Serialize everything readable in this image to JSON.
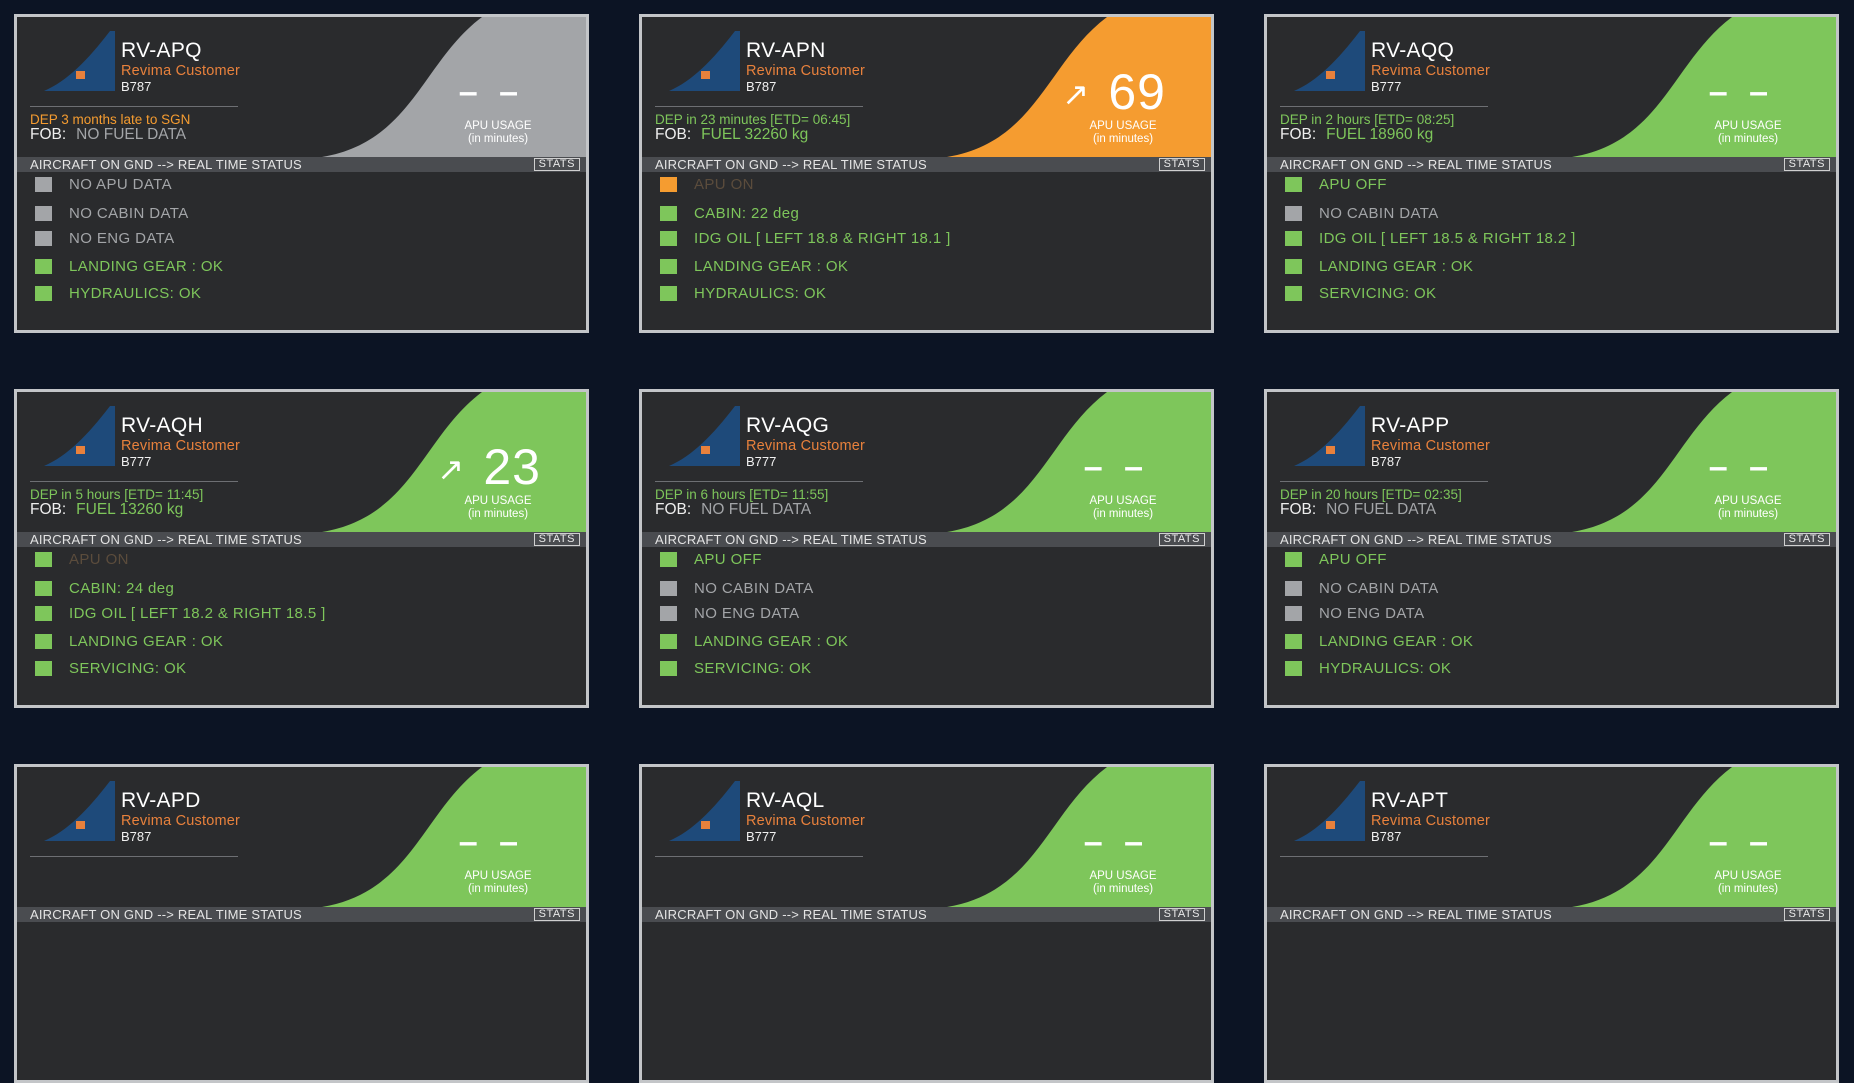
{
  "colors": {
    "background": "#0c1424",
    "panel": "#2a2b2d",
    "green": "#7ec65b",
    "orange": "#f59c30",
    "grey": "#a3a5a8",
    "dim": "#5b4c3c",
    "customer": "#e8813c",
    "tail_blue": "#1e4a7a",
    "tail_square": "#e8813c"
  },
  "labels": {
    "apu_usage": "APU USAGE",
    "apu_unit": "(in minutes)",
    "status_bar": "AIRCRAFT ON GND --> REAL TIME STATUS",
    "stats": "STATS",
    "fob": "FOB:",
    "arrow": "↗"
  },
  "cards": [
    {
      "reg": "RV-APQ",
      "customer": "Revima Customer",
      "type": "B787",
      "status_color": "grey",
      "dep": "DEP 3 months late to SGN",
      "dep_color": "orange",
      "fob": "NO FUEL DATA",
      "fob_color": "grey",
      "apu": "– –",
      "apu_has_value": false,
      "rows": [
        {
          "text": "NO APU DATA",
          "color": "grey"
        },
        {
          "text": "NO CABIN DATA",
          "color": "grey"
        },
        {
          "text": "NO ENG DATA",
          "color": "grey"
        },
        {
          "text": "LANDING GEAR : OK",
          "color": "green"
        },
        {
          "text": "HYDRAULICS: OK",
          "color": "green"
        }
      ]
    },
    {
      "reg": "RV-APN",
      "customer": "Revima Customer",
      "type": "B787",
      "status_color": "orange",
      "dep": "DEP in 23 minutes [ETD= 06:45]",
      "dep_color": "green",
      "fob": "FUEL 32260 kg",
      "fob_color": "green",
      "apu": "69",
      "apu_has_value": true,
      "rows": [
        {
          "text": "APU ON",
          "color": "dim",
          "square": "orange"
        },
        {
          "text": "CABIN: 22 deg",
          "color": "green"
        },
        {
          "text": "IDG OIL [ LEFT 18.8 & RIGHT 18.1 ]",
          "color": "green"
        },
        {
          "text": "LANDING GEAR : OK",
          "color": "green"
        },
        {
          "text": "HYDRAULICS: OK",
          "color": "green"
        }
      ]
    },
    {
      "reg": "RV-AQQ",
      "customer": "Revima Customer",
      "type": "B777",
      "status_color": "green",
      "dep": "DEP in 2 hours [ETD= 08:25]",
      "dep_color": "green",
      "fob": "FUEL 18960 kg",
      "fob_color": "green",
      "apu": "– –",
      "apu_has_value": false,
      "rows": [
        {
          "text": "APU OFF",
          "color": "green"
        },
        {
          "text": "NO CABIN DATA",
          "color": "grey"
        },
        {
          "text": "IDG OIL [ LEFT 18.5 & RIGHT 18.2 ]",
          "color": "green"
        },
        {
          "text": "LANDING GEAR : OK",
          "color": "green"
        },
        {
          "text": "SERVICING: OK",
          "color": "green"
        }
      ]
    },
    {
      "reg": "RV-AQH",
      "customer": "Revima Customer",
      "type": "B777",
      "status_color": "green",
      "dep": "DEP in 5 hours [ETD= 11:45]",
      "dep_color": "green",
      "fob": "FUEL 13260 kg",
      "fob_color": "green",
      "apu": "23",
      "apu_has_value": true,
      "rows": [
        {
          "text": "APU ON",
          "color": "dim",
          "square": "green"
        },
        {
          "text": "CABIN: 24 deg",
          "color": "green"
        },
        {
          "text": "IDG OIL [ LEFT 18.2 & RIGHT 18.5 ]",
          "color": "green"
        },
        {
          "text": "LANDING GEAR : OK",
          "color": "green"
        },
        {
          "text": "SERVICING: OK",
          "color": "green"
        }
      ]
    },
    {
      "reg": "RV-AQG",
      "customer": "Revima Customer",
      "type": "B777",
      "status_color": "green",
      "dep": "DEP in 6 hours [ETD= 11:55]",
      "dep_color": "green",
      "fob": "NO FUEL DATA",
      "fob_color": "grey",
      "apu": "– –",
      "apu_has_value": false,
      "rows": [
        {
          "text": "APU OFF",
          "color": "green"
        },
        {
          "text": "NO CABIN DATA",
          "color": "grey"
        },
        {
          "text": "NO ENG DATA",
          "color": "grey"
        },
        {
          "text": "LANDING GEAR : OK",
          "color": "green"
        },
        {
          "text": "SERVICING: OK",
          "color": "green"
        }
      ]
    },
    {
      "reg": "RV-APP",
      "customer": "Revima Customer",
      "type": "B787",
      "status_color": "green",
      "dep": "DEP in 20 hours [ETD= 02:35]",
      "dep_color": "green",
      "fob": "NO FUEL DATA",
      "fob_color": "grey",
      "apu": "– –",
      "apu_has_value": false,
      "rows": [
        {
          "text": "APU OFF",
          "color": "green"
        },
        {
          "text": "NO CABIN DATA",
          "color": "grey"
        },
        {
          "text": "NO ENG DATA",
          "color": "grey"
        },
        {
          "text": "LANDING GEAR : OK",
          "color": "green"
        },
        {
          "text": "HYDRAULICS: OK",
          "color": "green"
        }
      ]
    },
    {
      "reg": "RV-APD",
      "customer": "Revima Customer",
      "type": "B787",
      "status_color": "green",
      "dep": "",
      "dep_color": "green",
      "fob": "",
      "fob_color": "grey",
      "apu": "– –",
      "apu_has_value": false,
      "rows": []
    },
    {
      "reg": "RV-AQL",
      "customer": "Revima Customer",
      "type": "B777",
      "status_color": "green",
      "dep": "",
      "dep_color": "green",
      "fob": "",
      "fob_color": "grey",
      "apu": "– –",
      "apu_has_value": false,
      "rows": []
    },
    {
      "reg": "RV-APT",
      "customer": "Revima Customer",
      "type": "B787",
      "status_color": "green",
      "dep": "",
      "dep_color": "green",
      "fob": "",
      "fob_color": "grey",
      "apu": "– –",
      "apu_has_value": false,
      "rows": []
    }
  ]
}
